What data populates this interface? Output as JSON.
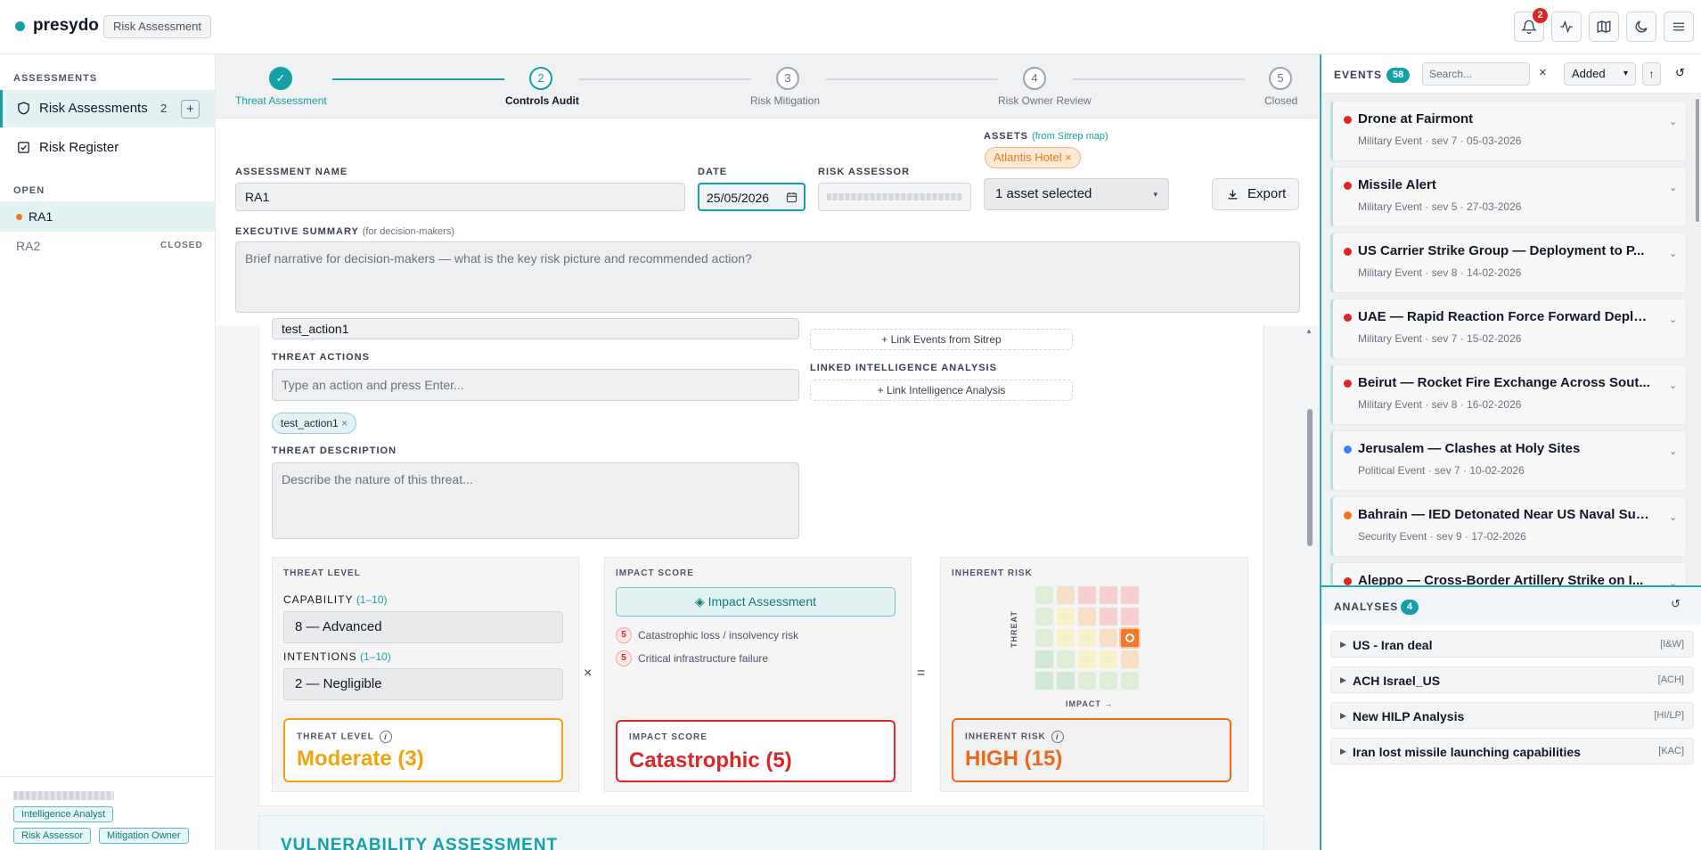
{
  "app": {
    "name": "presydo",
    "section": "Risk Assessment",
    "notification_count": "2"
  },
  "sidebar": {
    "assessments_header": "ASSESSMENTS",
    "items": [
      {
        "label": "Risk Assessments",
        "count": "2",
        "add": "+"
      },
      {
        "label": "Risk Register"
      }
    ],
    "open_header": "OPEN",
    "assessments": [
      {
        "name": "RA1",
        "status": ""
      },
      {
        "name": "RA2",
        "status": "CLOSED"
      }
    ],
    "roles": [
      "Intelligence Analyst",
      "Risk Assessor",
      "Mitigation Owner"
    ]
  },
  "stepper": {
    "steps": [
      {
        "num": "✓",
        "label": "Threat Assessment",
        "state": "done"
      },
      {
        "num": "2",
        "label": "Controls Audit",
        "state": "current"
      },
      {
        "num": "3",
        "label": "Risk Mitigation",
        "state": "todo"
      },
      {
        "num": "4",
        "label": "Risk Owner Review",
        "state": "todo"
      },
      {
        "num": "5",
        "label": "Closed",
        "state": "todo"
      }
    ]
  },
  "form": {
    "assets_label": "ASSETS",
    "assets_sub": "(from Sitrep map)",
    "asset_chip": "Atlantis Hotel",
    "name_label": "ASSESSMENT NAME",
    "name_value": "RA1",
    "date_label": "DATE",
    "date_value": "25/05/2026",
    "assessor_label": "RISK ASSESSOR",
    "asset_select": "1 asset selected",
    "export_label": "Export",
    "summary_label": "EXECUTIVE SUMMARY",
    "summary_sub": "(for decision-makers)",
    "summary_placeholder": "Brief narrative for decision-makers — what is the key risk picture and recommended action?"
  },
  "threat": {
    "prev_value": "test_action1",
    "actions_label": "THREAT ACTIONS",
    "actions_placeholder": "Type an action and press Enter...",
    "action_tag": "test_action1",
    "desc_label": "THREAT DESCRIPTION",
    "desc_placeholder": "Describe the nature of this threat...",
    "link_events": "+ Link Events from Sitrep",
    "linked_intel_label": "LINKED INTELLIGENCE ANALYSIS",
    "link_intel": "+ Link Intelligence Analysis",
    "level": {
      "header": "THREAT LEVEL",
      "capability_label": "CAPABILITY",
      "capability_range": "(1–10)",
      "capability_value": "8 — Advanced",
      "intentions_label": "INTENTIONS",
      "intentions_range": "(1–10)",
      "intentions_value": "2 — Negligible",
      "result_label": "THREAT LEVEL",
      "result_value": "Moderate (3)"
    },
    "impact": {
      "header": "IMPACT SCORE",
      "button": "Impact Assessment",
      "items": [
        {
          "score": "5",
          "text": "Catastrophic loss / insolvency risk"
        },
        {
          "score": "5",
          "text": "Critical infrastructure failure"
        }
      ],
      "result_label": "IMPACT SCORE",
      "result_value": "Catastrophic (5)"
    },
    "times": "×",
    "equals": "=",
    "inherent": {
      "header": "INHERENT RISK",
      "y_axis": "THREAT",
      "x_axis": "IMPACT →",
      "marker": {
        "threat": 3,
        "impact": 5
      },
      "result_label": "INHERENT RISK",
      "result_value": "HIGH (15)"
    }
  },
  "vulnerability_title": "VULNERABILITY ASSESSMENT",
  "events": {
    "header": "EVENTS",
    "count": "58",
    "search_placeholder": "Search...",
    "sort": "Added",
    "items": [
      {
        "title": "Drone at Fairmont",
        "meta": "Military Event · sev 7 · 05-03-2026",
        "color": "#dc2626"
      },
      {
        "title": "Missile Alert",
        "meta": "Military Event · sev 5 · 27-03-2026",
        "color": "#dc2626"
      },
      {
        "title": "US Carrier Strike Group — Deployment to P...",
        "meta": "Military Event · sev 8 · 14-02-2026",
        "color": "#dc2626"
      },
      {
        "title": "UAE — Rapid Reaction Force Forward Deplo...",
        "meta": "Military Event · sev 7 · 15-02-2026",
        "color": "#dc2626"
      },
      {
        "title": "Beirut — Rocket Fire Exchange Across Sout...",
        "meta": "Military Event · sev 8 · 16-02-2026",
        "color": "#dc2626"
      },
      {
        "title": "Jerusalem — Clashes at Holy Sites",
        "meta": "Political Event · sev 7 · 10-02-2026",
        "color": "#3b82f6"
      },
      {
        "title": "Bahrain — IED Detonated Near US Naval Sup...",
        "meta": "Security Event · sev 9 · 17-02-2026",
        "color": "#f97316"
      },
      {
        "title": "Aleppo — Cross-Border Artillery Strike on I...",
        "meta": "",
        "color": "#dc2626"
      }
    ]
  },
  "analyses": {
    "header": "ANALYSES",
    "count": "4",
    "items": [
      {
        "title": "US - Iran deal",
        "kind": "[I&W]"
      },
      {
        "title": "ACH Israel_US",
        "kind": "[ACH]"
      },
      {
        "title": "New HILP Analysis",
        "kind": "[HI/LP]"
      },
      {
        "title": "Iran lost missile launching capabilities",
        "kind": "[KAC]"
      }
    ]
  }
}
